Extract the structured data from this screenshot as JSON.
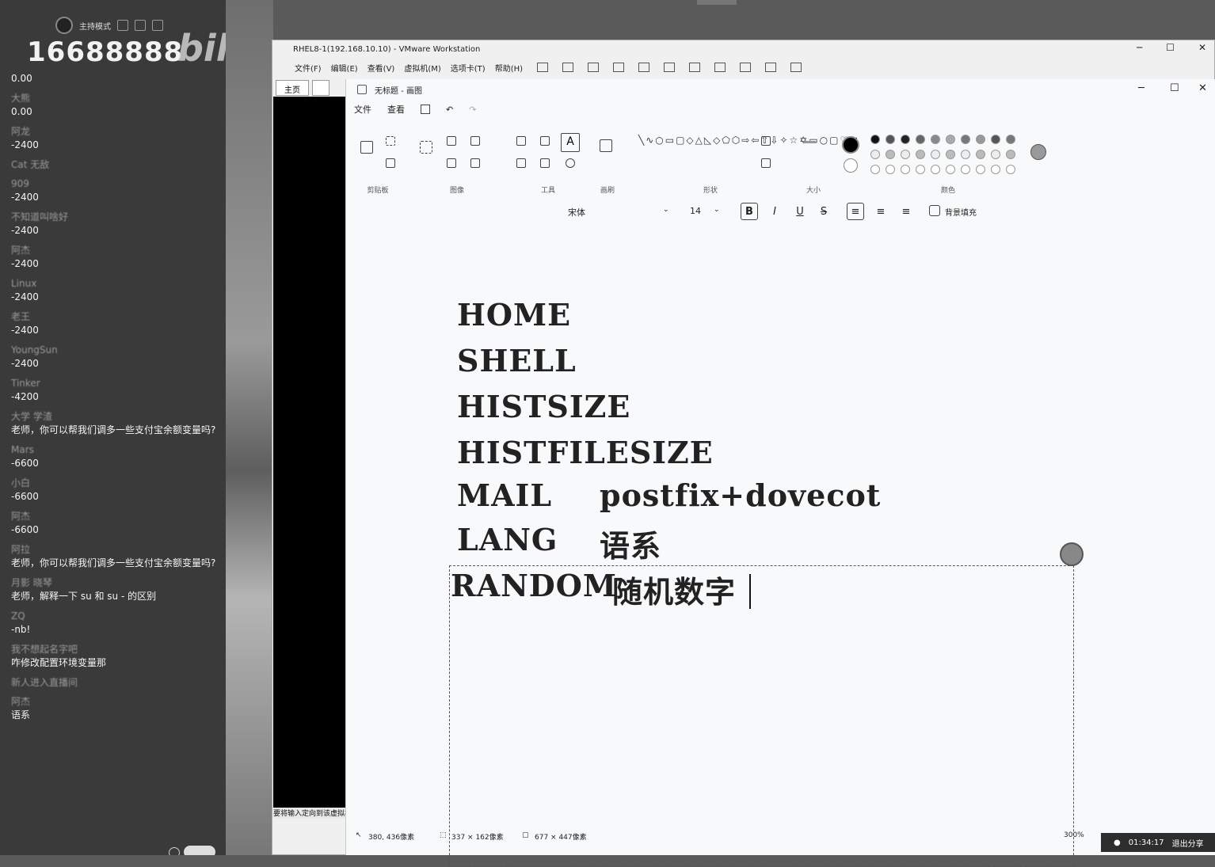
{
  "chat": {
    "room_number": "16688888",
    "site_logo": "bilibili",
    "mode_label": "主持模式",
    "messages": [
      {
        "name": "",
        "text": "0.00"
      },
      {
        "name": "大熊",
        "text": "0.00"
      },
      {
        "name": "阿龙",
        "text": "-2400"
      },
      {
        "name": "Cat 无敌",
        "text": ""
      },
      {
        "name": "909",
        "text": "-2400"
      },
      {
        "name": "不知道叫啥好",
        "text": "-2400"
      },
      {
        "name": "阿杰",
        "text": "-2400"
      },
      {
        "name": "Linux",
        "text": "-2400"
      },
      {
        "name": "老王",
        "text": "-2400"
      },
      {
        "name": "YoungSun",
        "text": "-2400"
      },
      {
        "name": "Tinker",
        "text": "-4200"
      },
      {
        "name": "大学 学渣",
        "text": "老师，你可以帮我们调多一些支付宝余额变量吗?"
      },
      {
        "name": "Mars",
        "text": "-6600"
      },
      {
        "name": "小白",
        "text": "-6600"
      },
      {
        "name": "阿杰",
        "text": "-6600"
      },
      {
        "name": "阿拉",
        "text": "老师，你可以帮我们调多一些支付宝余额变量吗?"
      },
      {
        "name": "月影 晓琴",
        "text": "老师，解释一下 su 和 su - 的区别"
      },
      {
        "name": "ZQ",
        "text": "-nb!"
      },
      {
        "name": "我不想起名字吧",
        "text": "咋修改配置环境变量那"
      },
      {
        "name": "新人进入直播间",
        "text": ""
      },
      {
        "name": "阿杰",
        "text": "语系"
      }
    ]
  },
  "vmware": {
    "title": "RHEL8-1(192.168.10.10) - VMware Workstation",
    "menu": [
      "文件(F)",
      "编辑(E)",
      "查看(V)",
      "虚拟机(M)",
      "选项卡(T)",
      "帮助(H)"
    ],
    "tabs": [
      "主页",
      ""
    ],
    "status_hint": "要将输入定向到该虚拟机"
  },
  "paint": {
    "title": "无标题 - 画图",
    "menu": [
      "文件",
      "查看"
    ],
    "groups": [
      "剪贴板",
      "图像",
      "工具",
      "画刷",
      "形状",
      "大小",
      "颜色"
    ],
    "font_name": "宋体",
    "font_size": "14",
    "bg_fill_label": "背景填充",
    "bold_on": true,
    "canvas_lines": [
      {
        "left": "HOME",
        "right": ""
      },
      {
        "left": "SHELL",
        "right": ""
      },
      {
        "left": "HISTSIZE",
        "right": ""
      },
      {
        "left": "HISTFILESIZE",
        "right": ""
      },
      {
        "left": "MAIL",
        "right": "postfix+dovecot"
      },
      {
        "left": "LANG",
        "right": "语系"
      },
      {
        "left": "RANDOM",
        "right": "随机数字"
      }
    ],
    "status": {
      "cursor_pos": "380, 436像素",
      "selection_size": "337 × 162像素",
      "canvas_size": "677 × 447像素",
      "zoom": "300%"
    },
    "primary_color": "#000000",
    "secondary_color": "#ffffff"
  },
  "taskbar": {
    "timer": "01:34:17",
    "exit_share": "退出分享"
  }
}
